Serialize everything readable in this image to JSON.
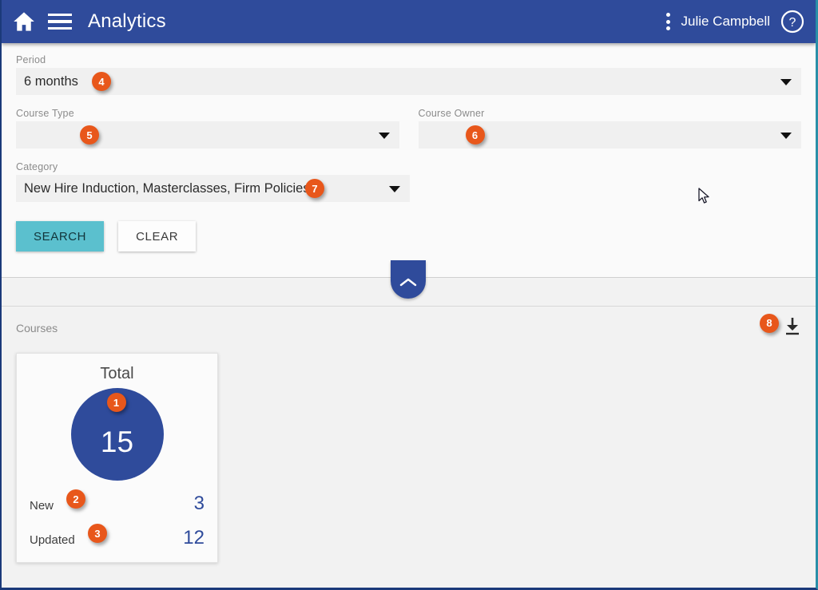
{
  "header": {
    "title": "Analytics",
    "user_name": "Julie Campbell",
    "home_icon": "home-icon",
    "menu_icon": "hamburger-menu-icon",
    "overflow_icon": "kebab-menu-icon",
    "help_icon": "help-circle-icon",
    "background_color": "#2f4b9b"
  },
  "filters": {
    "period": {
      "label": "Period",
      "value": "6 months",
      "badge": "4"
    },
    "course_type": {
      "label": "Course Type",
      "value": "",
      "badge": "5"
    },
    "course_owner": {
      "label": "Course Owner",
      "value": "",
      "badge": "6"
    },
    "category": {
      "label": "Category",
      "value": "New Hire Induction, Masterclasses, Firm Policies",
      "badge": "7"
    },
    "search_label": "SEARCH",
    "clear_label": "CLEAR",
    "search_color": "#5bc0ce",
    "collapse_icon": "chevron-up-icon"
  },
  "results": {
    "title": "Courses",
    "download_icon": "download-icon",
    "download_badge": "8",
    "card": {
      "title": "Total",
      "total_value": "15",
      "total_badge": "1",
      "stats": [
        {
          "label": "New",
          "value": "3",
          "badge": "2"
        },
        {
          "label": "Updated",
          "value": "12",
          "badge": "3"
        }
      ],
      "accent_color": "#2f4b9b"
    }
  },
  "cursor": {
    "icon": "mouse-pointer-icon"
  }
}
